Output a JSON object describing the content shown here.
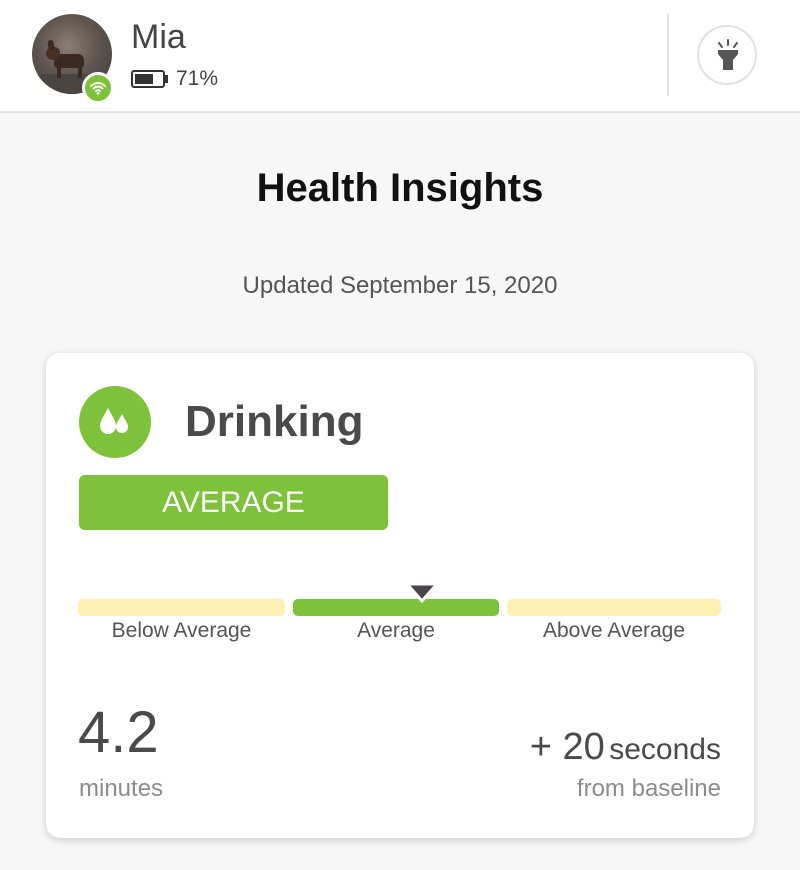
{
  "header": {
    "pet_name": "Mia",
    "battery_percent": "71%",
    "battery_level": 0.71,
    "avatar_icon": "pet-photo",
    "connection_icon": "wifi-icon",
    "light_icon": "flashlight-icon"
  },
  "page": {
    "title": "Health Insights",
    "updated": "Updated September 15, 2020"
  },
  "card": {
    "icon": "water-drops-icon",
    "title": "Drinking",
    "status": "AVERAGE",
    "scale": {
      "labels": [
        "Below Average",
        "Average",
        "Above Average"
      ],
      "current_index": 1
    },
    "metric_value": "4.2",
    "metric_unit": "minutes",
    "delta_value": "+ 20",
    "delta_unit": "seconds",
    "delta_caption": "from baseline"
  },
  "colors": {
    "accent_green": "#7ec13a",
    "scale_yellow": "#fdf0b3",
    "text_dark": "#4a4a4a",
    "text_muted": "#8c8c8c"
  }
}
